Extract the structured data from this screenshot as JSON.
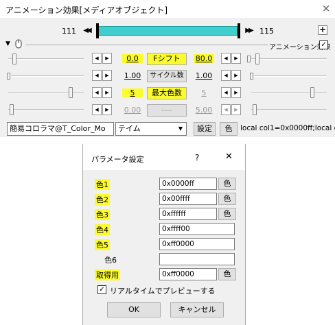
{
  "main_window": {
    "title": "アニメーション効果[メディアオブジェクト]",
    "close_glyph": "×",
    "frame_start": "111",
    "frame_end": "115",
    "plus_label": "+",
    "anim_effect_label": "アニメーション効果",
    "anim_effect_checked": true,
    "rows": [
      {
        "left_value": "0.0",
        "button": "Fシフト",
        "right_value": "80.0",
        "highlighted": true,
        "dim": false
      },
      {
        "left_value": "1.00",
        "button": "サイクル数",
        "right_value": "1.00",
        "highlighted": false,
        "dim": false
      },
      {
        "left_value": "5",
        "button": "最大色数",
        "right_value": "5",
        "highlighted": true,
        "dim": false
      },
      {
        "left_value": "0.00",
        "button": "----",
        "right_value": "5.00",
        "highlighted": false,
        "dim": true
      }
    ],
    "effect_select": "簡易コロラマ@T_Color_Mo",
    "mode_select": "テイム",
    "settings_button": "設定",
    "color_button": "色",
    "script_text": "local col1=0x0000ff;local c"
  },
  "dialog": {
    "title": "パラメータ設定",
    "help_glyph": "?",
    "close_glyph": "✕",
    "params": [
      {
        "label": "色1",
        "value": "0x0000ff",
        "has_color_button": true,
        "highlighted": true
      },
      {
        "label": "色2",
        "value": "0x00ffff",
        "has_color_button": true,
        "highlighted": true
      },
      {
        "label": "色3",
        "value": "0xffffff",
        "has_color_button": true,
        "highlighted": true
      },
      {
        "label": "色4",
        "value": "0xffff00",
        "has_color_button": false,
        "highlighted": true
      },
      {
        "label": "色5",
        "value": "0xff0000",
        "has_color_button": false,
        "highlighted": true
      },
      {
        "label": "色6",
        "value": "",
        "has_color_button": false,
        "highlighted": false
      },
      {
        "label": "取得用",
        "value": "0xff0000",
        "has_color_button": true,
        "highlighted": true
      }
    ],
    "color_button_label": "色",
    "realtime_preview_label": "リアルタイムでプレビューする",
    "realtime_preview_checked": true,
    "ok_label": "OK",
    "cancel_label": "キャンセル"
  },
  "colors": {
    "highlight": "#fbfb2d",
    "timeline": "#41cece"
  }
}
